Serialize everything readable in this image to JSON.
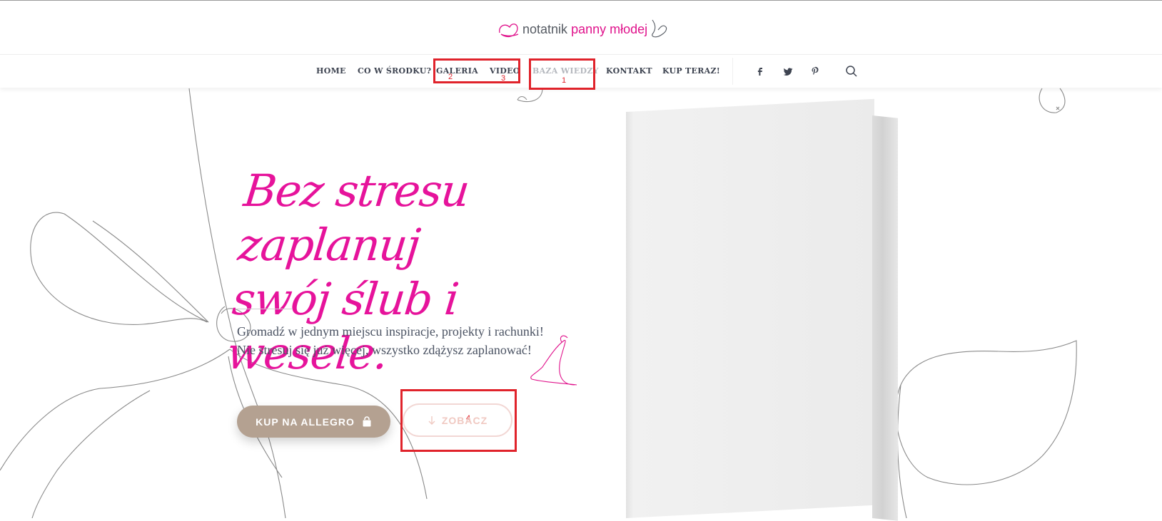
{
  "logo": {
    "text_plain": "notatnik",
    "text_accent": "panny młodej",
    "accent_color": "#e0138c",
    "icons": [
      "heart-doodle-icon",
      "heart-outline-icon"
    ]
  },
  "nav": {
    "items": [
      {
        "label": "HOME"
      },
      {
        "label": "CO W ŚRODKU?"
      },
      {
        "label": "GALERIA"
      },
      {
        "label": "VIDEO"
      },
      {
        "label": "BAZA WIEDZY",
        "active": true
      },
      {
        "label": "KONTAKT"
      },
      {
        "label": "KUP TERAZ!"
      }
    ],
    "social": [
      "facebook-icon",
      "twitter-icon",
      "pinterest-icon"
    ],
    "search_icon": "search-icon"
  },
  "annotations": [
    {
      "number": "1",
      "target": "BAZA WIEDZY"
    },
    {
      "number": "2",
      "target": "GALERIA"
    },
    {
      "number": "3",
      "target": "VIDEO"
    },
    {
      "number": "4",
      "target": "ZOBACZ"
    }
  ],
  "hero": {
    "title_line1": "Bez stresu zaplanuj",
    "title_line2": "swój ślub i wesele.",
    "title_color": "#e6139b",
    "desc_line1": "Gromadź w jednym miejscu inspiracje, projekty i rachunki!",
    "desc_line2": "Nie stresuj się już więcej, wszystko zdążysz zaplanować!",
    "primary_button": {
      "label": "KUP NA ALLEGRO",
      "icon": "shopping-bag-icon",
      "color": "#b4a191"
    },
    "secondary_button": {
      "label": "ZOBACZ",
      "icon": "arrow-down-icon"
    }
  },
  "colors": {
    "annotation": "#e0232b",
    "nav_text": "#3d4350",
    "nav_active": "#b5b8be"
  }
}
